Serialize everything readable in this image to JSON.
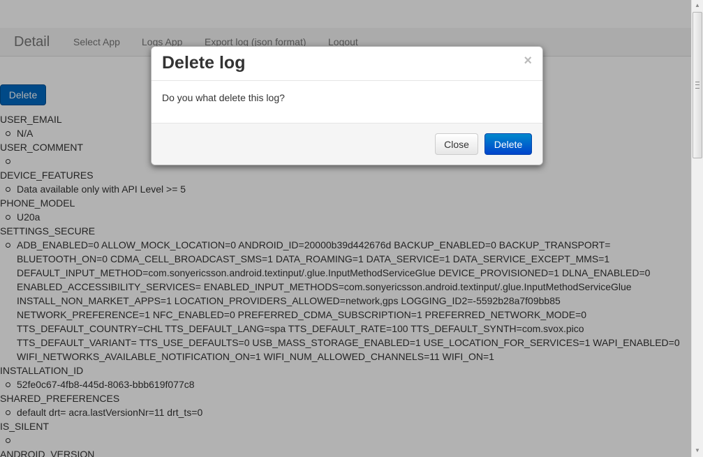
{
  "nav": {
    "brand": "Detail",
    "links": [
      "Select App",
      "Logs App",
      "Export log (json format)",
      "Logout"
    ]
  },
  "main": {
    "delete_label": "Delete"
  },
  "log": [
    {
      "key": "USER_EMAIL",
      "value": "N/A"
    },
    {
      "key": "USER_COMMENT",
      "value": ""
    },
    {
      "key": "DEVICE_FEATURES",
      "value": "Data available only with API Level >= 5"
    },
    {
      "key": "PHONE_MODEL",
      "value": "U20a"
    },
    {
      "key": "SETTINGS_SECURE",
      "value": "ADB_ENABLED=0 ALLOW_MOCK_LOCATION=0 ANDROID_ID=20000b39d442676d BACKUP_ENABLED=0 BACKUP_TRANSPORT= BLUETOOTH_ON=0 CDMA_CELL_BROADCAST_SMS=1 DATA_ROAMING=1 DATA_SERVICE=1 DATA_SERVICE_EXCEPT_MMS=1 DEFAULT_INPUT_METHOD=com.sonyericsson.android.textinput/.glue.InputMethodServiceGlue DEVICE_PROVISIONED=1 DLNA_ENABLED=0 ENABLED_ACCESSIBILITY_SERVICES= ENABLED_INPUT_METHODS=com.sonyericsson.android.textinput/.glue.InputMethodServiceGlue INSTALL_NON_MARKET_APPS=1 LOCATION_PROVIDERS_ALLOWED=network,gps LOGGING_ID2=-5592b28a7f09bb85 NETWORK_PREFERENCE=1 NFC_ENABLED=0 PREFERRED_CDMA_SUBSCRIPTION=1 PREFERRED_NETWORK_MODE=0 TTS_DEFAULT_COUNTRY=CHL TTS_DEFAULT_LANG=spa TTS_DEFAULT_RATE=100 TTS_DEFAULT_SYNTH=com.svox.pico TTS_DEFAULT_VARIANT= TTS_USE_DEFAULTS=0 USB_MASS_STORAGE_ENABLED=1 USE_LOCATION_FOR_SERVICES=1 WAPI_ENABLED=0 WIFI_NETWORKS_AVAILABLE_NOTIFICATION_ON=1 WIFI_NUM_ALLOWED_CHANNELS=11 WIFI_ON=1"
    },
    {
      "key": "INSTALLATION_ID",
      "value": "52fe0c67-4fb8-445d-8063-bbb619f077c8"
    },
    {
      "key": "SHARED_PREFERENCES",
      "value": "default drt= acra.lastVersionNr=11 drt_ts=0"
    },
    {
      "key": "IS_SILENT",
      "value": ""
    },
    {
      "key": "ANDROID_VERSION",
      "value": ""
    }
  ],
  "modal": {
    "title": "Delete log",
    "close_x": "×",
    "message": "Do you what delete this log?",
    "close_label": "Close",
    "delete_label": "Delete"
  },
  "icons": {
    "modal_close": "close-icon",
    "scroll_up": "chevron-up-icon",
    "scroll_down": "chevron-down-icon"
  },
  "colors": {
    "primary": "#0055cc",
    "backdrop": "#4d4d4d"
  }
}
